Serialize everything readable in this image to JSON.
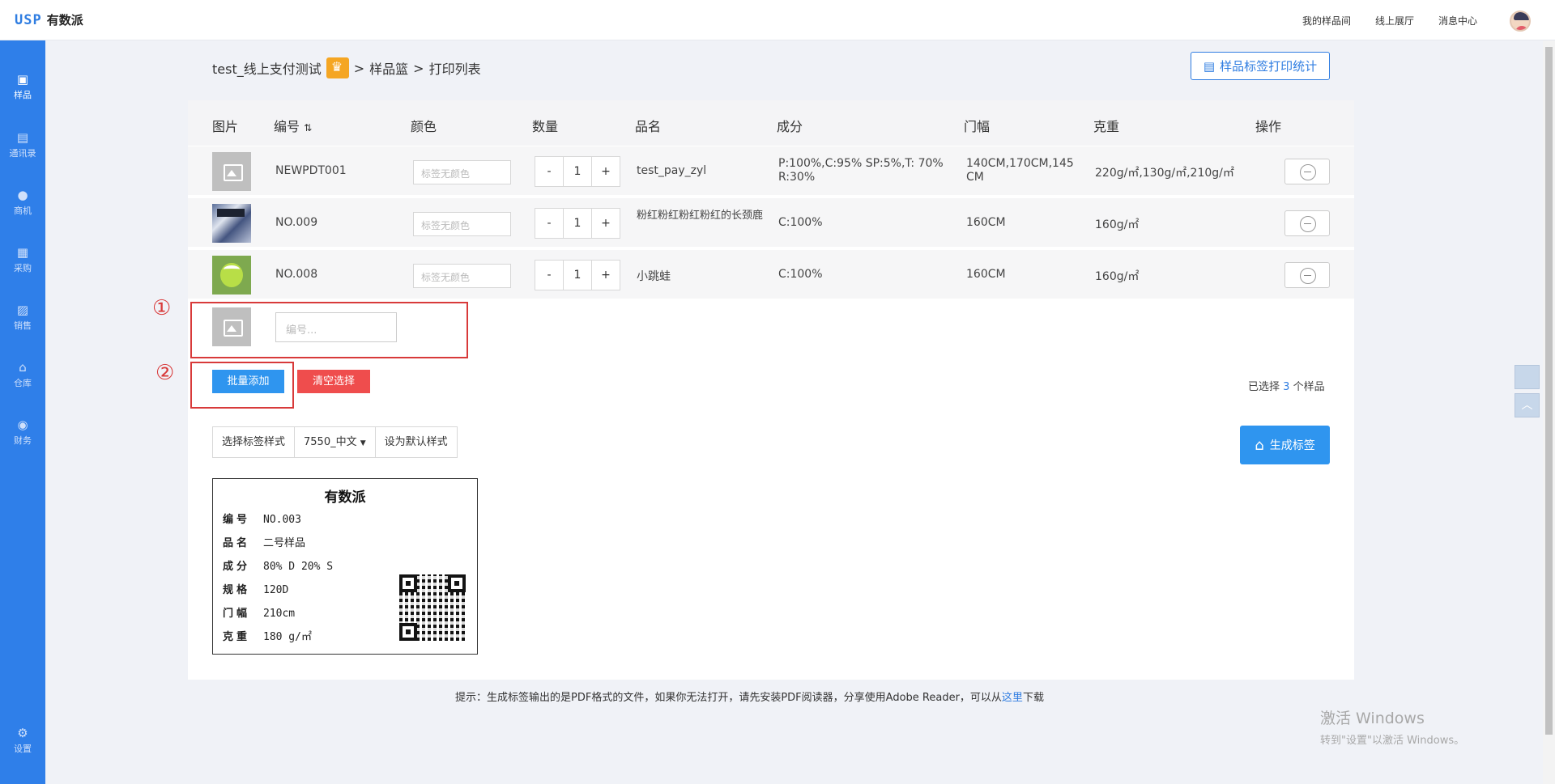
{
  "header": {
    "logo_mark": "USP",
    "logo_text": "有数派",
    "nav": [
      "我的样品间",
      "线上展厅",
      "消息中心"
    ]
  },
  "sidebar": {
    "items": [
      {
        "label": "样品",
        "icon": "sample-icon",
        "active": true
      },
      {
        "label": "通讯录",
        "icon": "contacts-icon"
      },
      {
        "label": "商机",
        "icon": "opportunity-icon"
      },
      {
        "label": "采购",
        "icon": "purchase-icon"
      },
      {
        "label": "销售",
        "icon": "sales-icon"
      },
      {
        "label": "仓库",
        "icon": "warehouse-icon"
      },
      {
        "label": "财务",
        "icon": "finance-icon"
      }
    ],
    "settings_label": "设置"
  },
  "breadcrumb": {
    "shop": "test_线上支付测试",
    "sep": ">",
    "level1": "样品篮",
    "level2": "打印列表"
  },
  "stats_button": "样品标签打印统计",
  "table": {
    "headers": [
      "图片",
      "编号",
      "颜色",
      "数量",
      "品名",
      "成分",
      "门幅",
      "克重",
      "操作"
    ],
    "sort_icon": "⇅",
    "rows": [
      {
        "image": "placeholder",
        "code": "NEWPDT001",
        "color_placeholder": "标签无颜色",
        "qty": "1",
        "name": "test_pay_zyl",
        "composition": "P:100%,C:95% SP:5%,T: 70% R:30%",
        "width": "140CM,170CM,145CM",
        "weight": "220g/㎡,130g/㎡,210g/㎡"
      },
      {
        "image": "fabric",
        "code": "NO.009",
        "color_placeholder": "标签无颜色",
        "qty": "1",
        "name": "粉红粉红粉红粉红的长颈鹿",
        "composition": "C:100%",
        "width": "160CM",
        "weight": "160g/㎡"
      },
      {
        "image": "frog",
        "code": "NO.008",
        "color_placeholder": "标签无颜色",
        "qty": "1",
        "name": "小跳蛙",
        "composition": "C:100%",
        "width": "160CM",
        "weight": "160g/㎡"
      }
    ],
    "qty_minus": "-",
    "qty_plus": "+"
  },
  "new_row": {
    "code_placeholder": "编号..."
  },
  "annotations": {
    "one": "①",
    "two": "②"
  },
  "actions": {
    "batch_add": "批量添加",
    "clear": "清空选择",
    "selected_prefix": "已选择",
    "selected_count": "3",
    "selected_suffix": "个样品"
  },
  "label_style": {
    "choose": "选择标签样式",
    "current": "7550_中文",
    "set_default": "设为默认样式"
  },
  "generate_button": "生成标签",
  "label_preview": {
    "title": "有数派",
    "fields": [
      {
        "k": "编号",
        "v": "NO.003"
      },
      {
        "k": "品名",
        "v": "二号样品"
      },
      {
        "k": "成分",
        "v": "80% D 20% S"
      },
      {
        "k": "规格",
        "v": "120D"
      },
      {
        "k": "门幅",
        "v": "210cm"
      },
      {
        "k": "克重",
        "v": "180 g/㎡"
      }
    ]
  },
  "tip": {
    "text": "提示：生成标签输出的是PDF格式的文件，如果你无法打开，请先安装PDF阅读器，分享使用Adobe Reader，可以从",
    "link": "这里",
    "after": "下载"
  },
  "watermark": {
    "line1": "激活 Windows",
    "line2": "转到\"设置\"以激活 Windows。"
  },
  "colors": {
    "primary": "#2f95ef",
    "sidebar": "#2f7fe9",
    "danger": "#ef4d4d",
    "annotation": "#d83a3a"
  }
}
